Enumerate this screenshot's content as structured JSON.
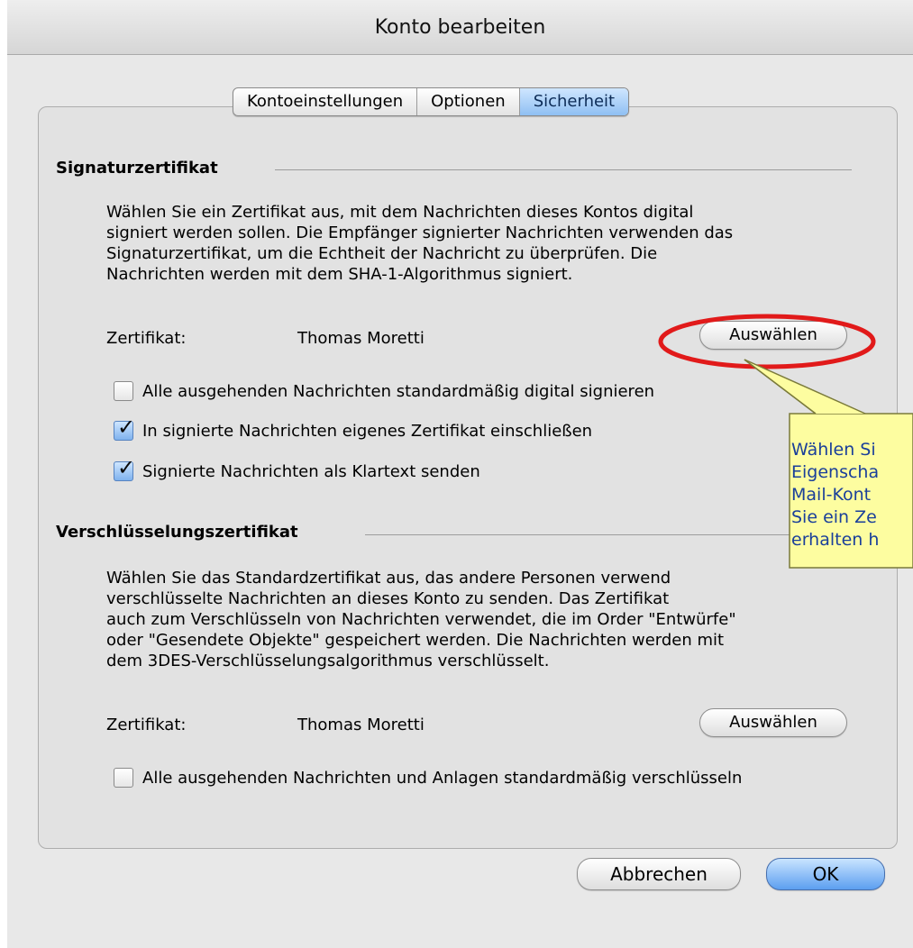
{
  "window": {
    "title": "Konto bearbeiten"
  },
  "tabs": [
    {
      "label": "Kontoeinstellungen",
      "active": false
    },
    {
      "label": "Optionen",
      "active": false
    },
    {
      "label": "Sicherheit",
      "active": true
    }
  ],
  "signature": {
    "title": "Signaturzertifikat",
    "description_lines": [
      "Wählen Sie ein Zertifikat aus, mit dem Nachrichten dieses Kontos digital",
      "signiert werden sollen. Die Empfänger signierter Nachrichten verwenden das",
      "Signaturzertifikat, um die Echtheit der Nachricht zu überprüfen. Die",
      "Nachrichten werden mit dem SHA-1-Algorithmus signiert."
    ],
    "cert_label": "Zertifikat:",
    "cert_value": "Thomas Moretti",
    "select_button": "Auswählen",
    "options": [
      {
        "label": "Alle ausgehenden Nachrichten standardmäßig digital signieren",
        "checked": false
      },
      {
        "label": "In signierte Nachrichten eigenes Zertifikat einschließen",
        "checked": true
      },
      {
        "label": "Signierte Nachrichten als Klartext senden",
        "checked": true
      }
    ]
  },
  "encryption": {
    "title": "Verschlüsselungszertifikat",
    "description_lines": [
      "Wählen Sie das Standardzertifikat aus, das andere Personen verwend",
      "verschlüsselte Nachrichten an dieses Konto zu senden. Das Zertifikat",
      "auch zum Verschlüsseln von Nachrichten verwendet, die im Order \"Entwürfe\"",
      "oder \"Gesendete Objekte\" gespeichert werden. Die Nachrichten werden mit",
      "dem 3DES-Verschlüsselungsalgorithmus verschlüsselt."
    ],
    "cert_label": "Zertifikat:",
    "cert_value": "Thomas Moretti",
    "select_button": "Auswählen",
    "options": [
      {
        "label": "Alle ausgehenden Nachrichten und Anlagen standardmäßig verschlüsseln",
        "checked": false
      }
    ]
  },
  "callout": {
    "lines": [
      "Wählen Si",
      "Eigenscha",
      "Mail-Kont",
      "Sie ein Ze",
      "erhalten h"
    ]
  },
  "footer": {
    "cancel": "Abbrechen",
    "ok": "OK"
  },
  "colors": {
    "highlight_ellipse": "#e11a1a",
    "callout_fill": "#fdfda0",
    "accent": "#5c9ff0"
  }
}
